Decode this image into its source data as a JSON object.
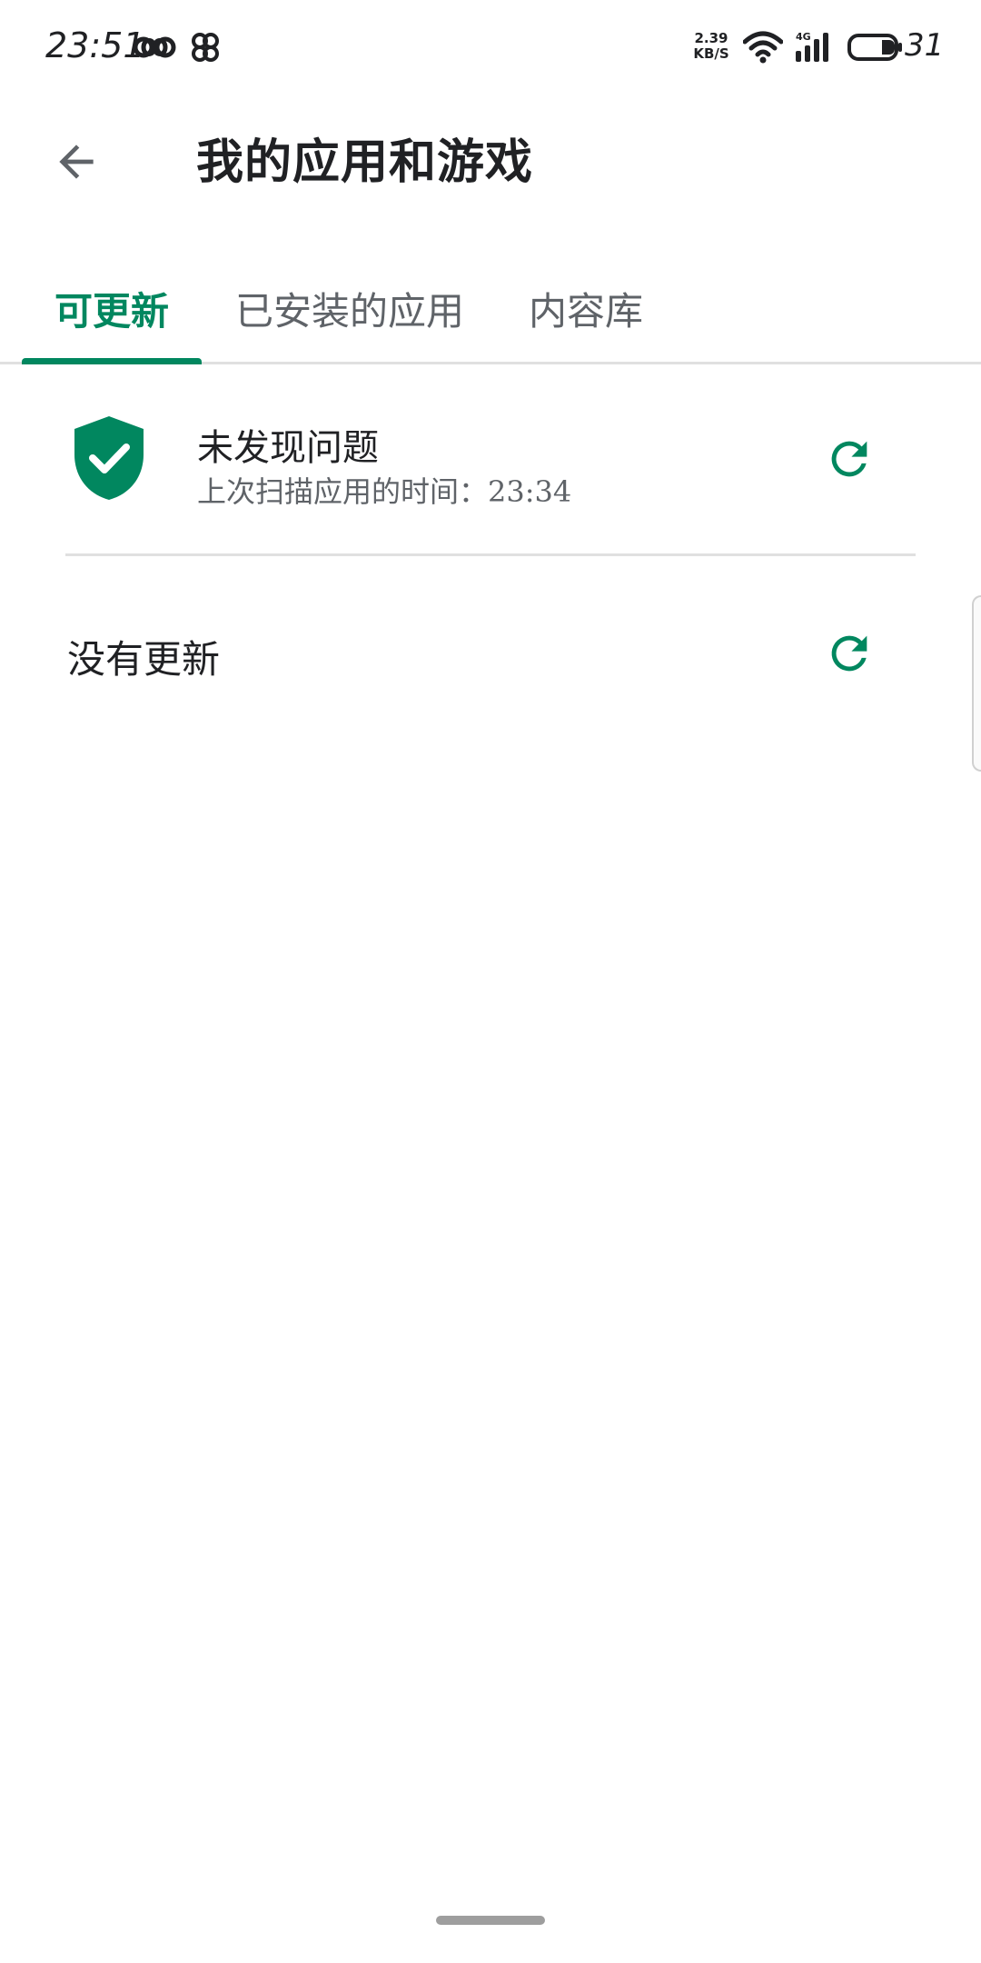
{
  "status_bar": {
    "time": "23:51",
    "network_speed_value": "2.39",
    "network_speed_unit": "KB/S",
    "network_type": "4G",
    "battery_level": "31",
    "icons": [
      "infinity-icon",
      "cloverleaf-icon",
      "wifi-icon",
      "signal-icon",
      "battery-icon"
    ]
  },
  "app_bar": {
    "title": "我的应用和游戏",
    "back_icon": "arrow-back-icon"
  },
  "tabs": [
    {
      "label": "可更新",
      "active": true
    },
    {
      "label": "已安装的应用",
      "active": false
    },
    {
      "label": "内容库",
      "active": false
    }
  ],
  "security": {
    "title": "未发现问题",
    "subtitle": "上次扫描应用的时间：23:34",
    "icon": "shield-check-icon",
    "refresh_icon": "refresh-icon"
  },
  "updates": {
    "label": "没有更新",
    "refresh_icon": "refresh-icon"
  },
  "colors": {
    "accent": "#01875f",
    "text_primary": "#202124",
    "text_secondary": "#5f6368",
    "divider": "#e0e0e0"
  }
}
